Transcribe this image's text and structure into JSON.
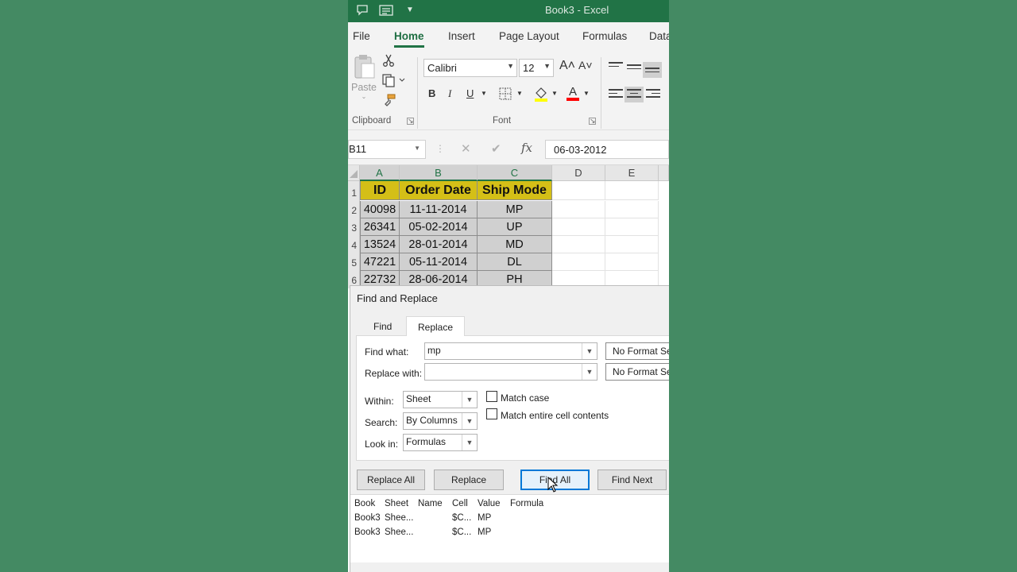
{
  "window": {
    "title": "Book3  -  Excel"
  },
  "ribbon_tabs": [
    "File",
    "Home",
    "Insert",
    "Page Layout",
    "Formulas",
    "Data"
  ],
  "ribbon": {
    "paste_label": "Paste",
    "clipboard_label": "Clipboard",
    "font_label": "Font",
    "font_name": "Calibri",
    "font_size": "12",
    "grow_font": "A˄",
    "shrink_font": "A˅",
    "bold": "B",
    "italic": "I",
    "underline": "U",
    "font_color_glyph": "A",
    "fill_color": "#ffff00",
    "font_color": "#ff0000"
  },
  "formula_bar": {
    "name_box": "B11",
    "cancel": "✕",
    "enter": "✔",
    "fx": "fx",
    "value": "06-03-2012"
  },
  "sheet": {
    "columns": [
      "A",
      "B",
      "C",
      "D",
      "E"
    ],
    "row_numbers": [
      "1",
      "2",
      "3",
      "4",
      "5",
      "6"
    ],
    "headers": [
      "ID",
      "Order Date",
      "Ship Mode"
    ],
    "rows": [
      [
        "40098",
        "11-11-2014",
        "MP"
      ],
      [
        "26341",
        "05-02-2014",
        "UP"
      ],
      [
        "13524",
        "28-01-2014",
        "MD"
      ],
      [
        "47221",
        "05-11-2014",
        "DL"
      ],
      [
        "22732",
        "28-06-2014",
        "PH"
      ]
    ],
    "header_fill": "#d4bf17"
  },
  "dialog": {
    "title": "Find and Replace",
    "tabs": [
      "Find",
      "Replace"
    ],
    "find_what_label": "Find what:",
    "find_what_value": "mp",
    "replace_with_label": "Replace with:",
    "replace_with_value": "",
    "format_button_1": "No Format Set",
    "format_button_2": "No Format Set",
    "within_label": "Within:",
    "within_value": "Sheet",
    "search_label": "Search:",
    "search_value": "By Columns",
    "lookin_label": "Look in:",
    "lookin_value": "Formulas",
    "match_case": "Match case",
    "match_entire": "Match entire cell contents",
    "buttons": {
      "replace_all": "Replace All",
      "replace": "Replace",
      "find_all": "Find All",
      "find_next": "Find Next"
    },
    "results": {
      "columns": [
        "Book",
        "Sheet",
        "Name",
        "Cell",
        "Value",
        "Formula"
      ],
      "rows": [
        [
          "Book3",
          "Shee...",
          "",
          "$C...",
          "MP",
          ""
        ],
        [
          "Book3",
          "Shee...",
          "",
          "$C...",
          "MP",
          ""
        ]
      ]
    }
  }
}
